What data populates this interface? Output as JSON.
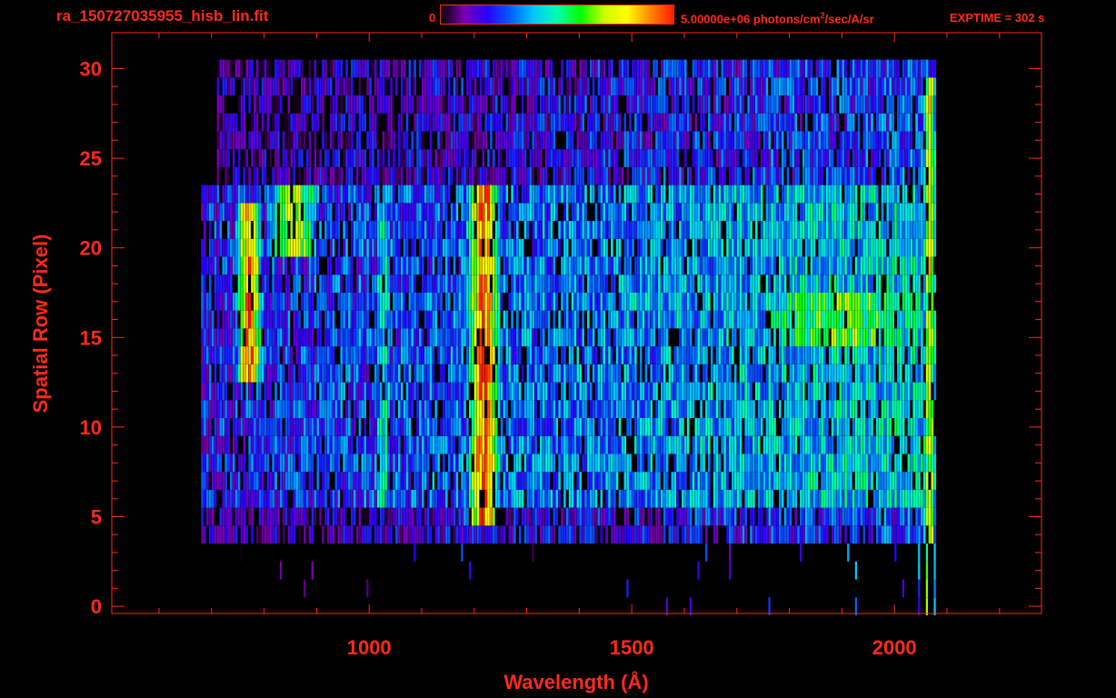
{
  "header": {
    "title": "ra_150727035955_hisb_lin.fit",
    "colorbar_min": "0",
    "colorbar_max_prefix": "5.00000e+06 photons/cm",
    "colorbar_max_sup": "2",
    "colorbar_max_suffix": "/sec/A/sr",
    "exptime": "EXPTIME = 302 s"
  },
  "colors": {
    "axis": "#ff2a1a",
    "background": "#000000",
    "colormap": [
      "#000000",
      "#7a00b0",
      "#2a00ff",
      "#0060ff",
      "#00c8ff",
      "#00ffb0",
      "#00ff00",
      "#c8ff00",
      "#ffff00",
      "#ff8800",
      "#ff1a00"
    ]
  },
  "chart_data": {
    "type": "heatmap",
    "title": "ra_150727035955_hisb_lin.fit",
    "xlabel": "Wavelength (Å)",
    "ylabel": "Spatial Row (Pixel)",
    "xlim": [
      510,
      2280
    ],
    "ylim": [
      -0.4,
      32
    ],
    "x_ticks": [
      1000,
      1500,
      2000
    ],
    "x_tick_labels": [
      "1000",
      "1500",
      "2000"
    ],
    "y_ticks": [
      0,
      5,
      10,
      15,
      20,
      25,
      30
    ],
    "y_tick_labels": [
      "0",
      "5",
      "10",
      "15",
      "20",
      "25",
      "30"
    ],
    "colorbar": {
      "min": 0,
      "max": 5000000,
      "units": "photons/cm^2/sec/A/sr"
    },
    "exptime_s": 302,
    "rows": {
      "data_rows": [
        4,
        30
      ],
      "bright_band_rows": [
        6,
        23
      ],
      "sparse_rows": [
        0,
        3
      ],
      "wavelength_range": [
        680,
        2075
      ]
    },
    "features": [
      {
        "wavelength_center": 770,
        "width": 30,
        "rows": [
          13,
          22
        ],
        "intensity": 0.9
      },
      {
        "wavelength_center": 855,
        "width": 60,
        "rows": [
          20,
          23
        ],
        "intensity": 0.7
      },
      {
        "wavelength_center": 1025,
        "width": 25,
        "rows": [
          6,
          23
        ],
        "intensity": 0.45
      },
      {
        "wavelength_center": 1216,
        "width": 40,
        "rows": [
          5,
          23
        ],
        "intensity": 0.92
      },
      {
        "wavelength_center": 1900,
        "width": 300,
        "rows": [
          15,
          17
        ],
        "intensity": 0.6
      },
      {
        "wavelength_center": 2065,
        "width": 15,
        "rows": [
          0,
          29
        ],
        "intensity": 0.75
      }
    ]
  }
}
